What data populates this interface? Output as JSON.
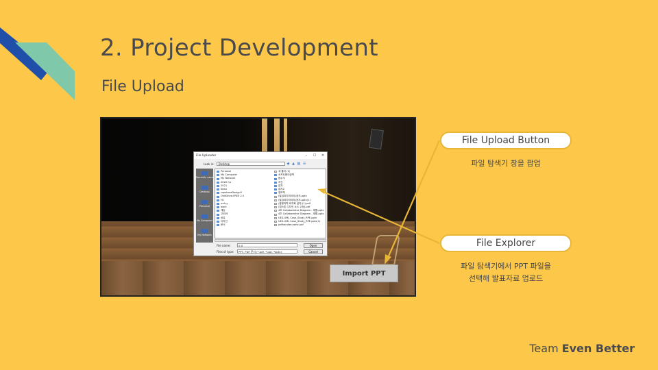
{
  "slide": {
    "title": "2. Project Development",
    "subtitle": "File Upload",
    "footer_prefix": "Team ",
    "footer_bold": "Even Better",
    "colors": {
      "background": "#FDC84A",
      "accent": "#E8B637",
      "deco_blue": "#1F4FA8",
      "deco_teal": "#7FC8A9"
    }
  },
  "screenshot": {
    "import_button": "Import PPT",
    "dialog": {
      "title": "File Uploader",
      "window_buttons": [
        "–",
        "☐",
        "✕"
      ],
      "look_in_label": "Look in:",
      "look_in_value": "Desktop",
      "places": [
        "Recently used",
        "Desktop",
        "Personal",
        "My Computer",
        "My Network"
      ],
      "files_col1": [
        "Personal",
        "My Computer",
        "My Network",
        "2020 Cp",
        "2021",
        "beau",
        "capstoneDesign2",
        "OneDrive-FREE 2.5",
        "HL",
        "mdr-y",
        "work",
        "게임",
        "고도화",
        "공유",
        "디자인",
        "문서"
      ],
      "files_col2": [
        "새 폴더 (2)",
        "소프트웨어공학",
        "음수식",
        "자신",
        "잡지",
        "잡지2",
        "정보처",
        "(발급과다미이야)공지.pptx",
        "(발급과다미이야)공지.pptx(1)",
        "(응용과학 바자회 공지)(1).pdf",
        "(캡스톤 디자인 소스 수정).pdf",
        "4조 Collaborative Diagram - 재활.pptx",
        "4조 Collaborative Diagram - 재활.pptx",
        "UES-UML Case_Study_RPE.pptx",
        "UES-UML Case_Study_RPE.pptx(1)",
        "pdfhandler.awhc.pdf"
      ],
      "file_name_label": "File name:",
      "file_name_value": "0.0",
      "file_type_label": "Files of type:",
      "file_type_value": "PPT, PDF 문서 (*.pdf, *.ppt, *pptx)",
      "open_label": "Open",
      "cancel_label": "Cancel"
    }
  },
  "callouts": [
    {
      "label": "File Upload Button",
      "description": [
        "파일 탐색기 창을 팝업"
      ]
    },
    {
      "label": "File Explorer",
      "description": [
        "파일 탐색기에서 PPT 파일을",
        "선택해 발표자료 업로드"
      ]
    }
  ]
}
